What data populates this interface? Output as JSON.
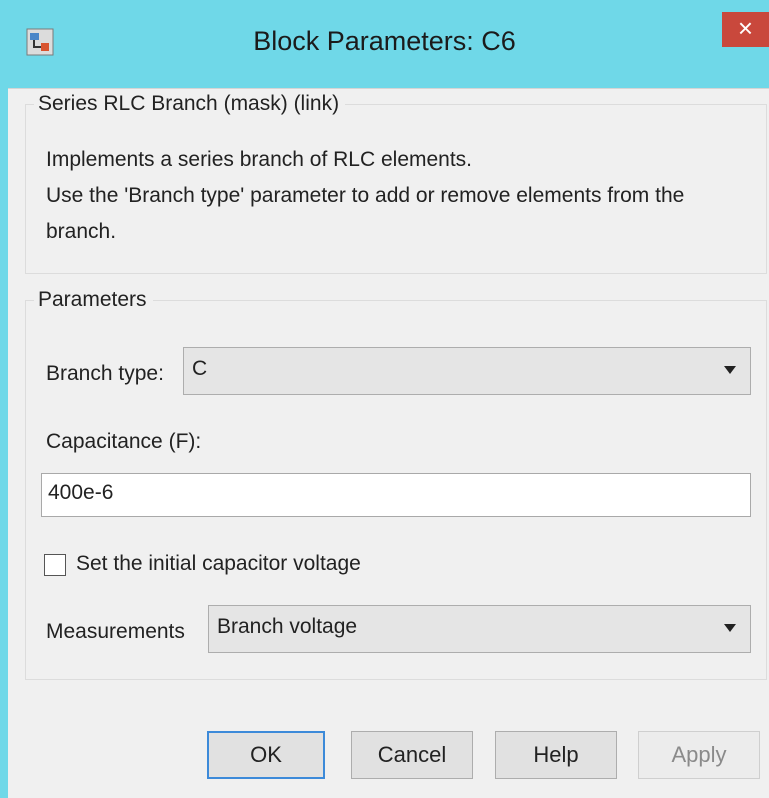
{
  "window": {
    "title": "Block Parameters: C6",
    "close_glyph": "×"
  },
  "description": {
    "legend": "Series RLC Branch (mask) (link)",
    "line1": "Implements a series branch of RLC elements.",
    "line2": "Use the 'Branch type' parameter to add or remove elements from the",
    "line3": "branch."
  },
  "parameters": {
    "legend": "Parameters",
    "branch_type_label": "Branch type:",
    "branch_type_value": "C",
    "capacitance_label": "Capacitance (F):",
    "capacitance_value": "400e-6",
    "initial_voltage_label": "Set the initial capacitor voltage",
    "initial_voltage_checked": false,
    "measurements_label": "Measurements",
    "measurements_value": "Branch voltage"
  },
  "buttons": {
    "ok": "OK",
    "cancel": "Cancel",
    "help": "Help",
    "apply": "Apply"
  },
  "colors": {
    "titlebar": "#6fd8e8",
    "close": "#c9483c",
    "default_border": "#3c8ad9"
  },
  "icons": {
    "app": "simulink-block-icon",
    "close": "close-icon",
    "dropdown": "chevron-down-icon"
  }
}
